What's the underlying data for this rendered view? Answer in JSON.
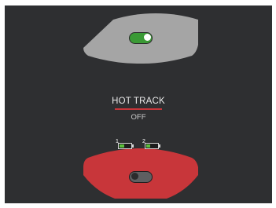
{
  "hot_track": {
    "title": "HOT TRACK",
    "state": "OFF"
  },
  "colors": {
    "background": "#2e2f31",
    "top_arc": "#a5a5a5",
    "bottom_arc": "#c8363a",
    "toggle_on": "#3a9a35",
    "toggle_off": "#5e5f61"
  },
  "top_toggle": {
    "on": true
  },
  "bottom_toggle": {
    "on": false
  },
  "batteries": [
    {
      "number": "1",
      "level": 0.45
    },
    {
      "number": "2",
      "level": 0.35
    }
  ]
}
